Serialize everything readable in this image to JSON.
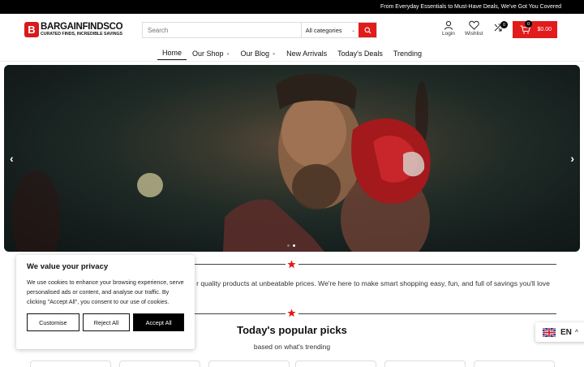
{
  "topbar": {
    "text": "From Everyday Essentials to Must-Have Deals, We've Got You Covered"
  },
  "logo": {
    "mark": "B",
    "name": "BARGAINFINDSCO",
    "tagline": "CURATED FINDS, INCREDIBLE SAVINGS"
  },
  "search": {
    "placeholder": "Search",
    "category": "All categories"
  },
  "header": {
    "login_label": "Login",
    "wishlist_label": "Wishlist",
    "compare_count": "0",
    "cart_count": "0",
    "cart_total": "$0.00"
  },
  "nav": {
    "home": "Home",
    "shop": "Our Shop",
    "blog": "Our Blog",
    "new_arrivals": "New Arrivals",
    "todays_deals": "Today's Deals",
    "trending": "Trending"
  },
  "hero": {
    "prev": "‹",
    "next": "›",
    "slide_count": 2,
    "active_slide": 2
  },
  "intro": {
    "text": "r quality products at unbeatable prices. We're here to make smart shopping easy, fun, and full of savings you'll love"
  },
  "popular": {
    "title": "Today's popular picks",
    "subtitle": "based on what's trending"
  },
  "cookie": {
    "title": "We value your privacy",
    "body": "We use cookies to enhance your browsing experience, serve personalised ads or content, and analyse our traffic. By clicking \"Accept All\", you consent to our use of cookies.",
    "customise": "Customise",
    "reject": "Reject All",
    "accept": "Accept All"
  },
  "language": {
    "code": "EN"
  },
  "colors": {
    "accent": "#e21b1b",
    "topbar": "#000000"
  }
}
